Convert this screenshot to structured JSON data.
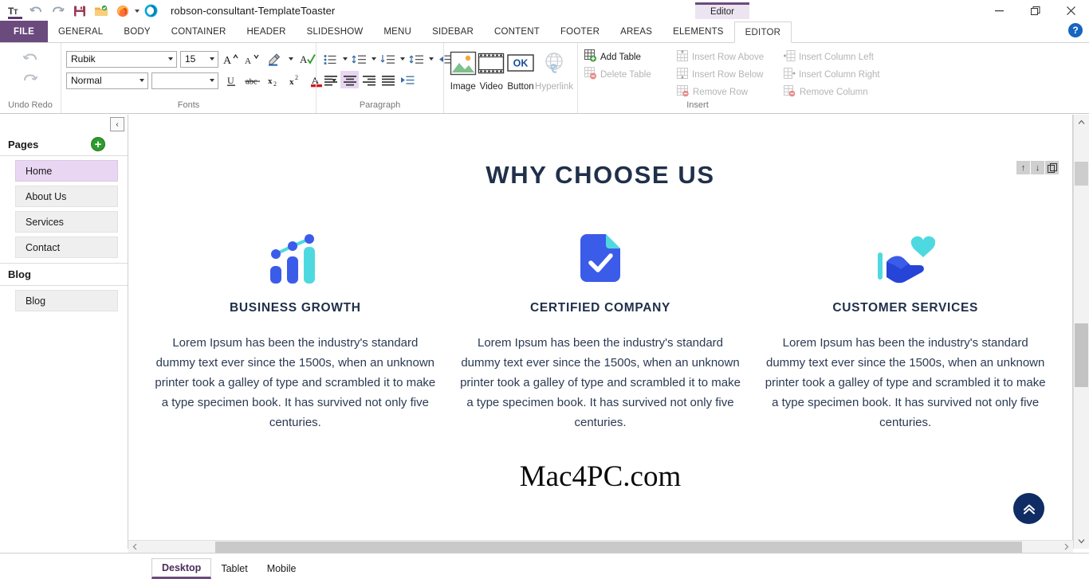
{
  "titlebar": {
    "quick_access": [
      {
        "name": "text-tool-icon",
        "label": "Tt"
      },
      {
        "name": "undo-icon",
        "label": "Undo"
      },
      {
        "name": "redo-icon",
        "label": "Redo"
      },
      {
        "name": "save-icon",
        "label": "Save"
      },
      {
        "name": "open-folder-icon",
        "label": "Open"
      },
      {
        "name": "firefox-preview-icon",
        "label": "Preview in Firefox"
      },
      {
        "name": "templatetoaster-icon",
        "label": "TemplateToaster"
      }
    ],
    "title": "robson-consultant-TemplateToaster",
    "doc_tab": "Editor",
    "window_controls": {
      "minimize": "—",
      "maximize": "❐",
      "close": "✕"
    },
    "help": "?"
  },
  "ribbon_tabs": {
    "file": "FILE",
    "items": [
      {
        "label": "GENERAL",
        "active": false
      },
      {
        "label": "BODY",
        "active": false
      },
      {
        "label": "CONTAINER",
        "active": false
      },
      {
        "label": "HEADER",
        "active": false
      },
      {
        "label": "SLIDESHOW",
        "active": false
      },
      {
        "label": "MENU",
        "active": false
      },
      {
        "label": "SIDEBAR",
        "active": false
      },
      {
        "label": "CONTENT",
        "active": false
      },
      {
        "label": "FOOTER",
        "active": false
      },
      {
        "label": "AREAS",
        "active": false
      },
      {
        "label": "ELEMENTS",
        "active": false
      },
      {
        "label": "EDITOR",
        "active": true
      }
    ]
  },
  "ribbon": {
    "undo_group": {
      "label": "Undo Redo",
      "undo": "Undo",
      "redo": "Redo"
    },
    "fonts_group": {
      "label": "Fonts",
      "font_family": "Rubik",
      "font_size": "15",
      "style": "Normal",
      "style2": "",
      "grow_font": "A",
      "shrink_font": "A",
      "highlight": "Highlight Color",
      "spelling": "Spelling",
      "underline": "U",
      "strikethrough": "abc",
      "subscript": "x₂",
      "superscript": "x²",
      "font_color": "A",
      "clear_format": "A"
    },
    "paragraph_group": {
      "label": "Paragraph",
      "bullets": "Bullets",
      "numbering": "Numbering",
      "line_spacing": "Line Spacing",
      "multilevel": "Multilevel List",
      "indent": "Increase Indent",
      "format_painter": "Format Painter",
      "align_left": "Align Left",
      "align_center": "Align Center",
      "align_right": "Align Right",
      "justify": "Justify",
      "outdent": "Decrease Indent"
    },
    "insert_group": {
      "label": "Insert",
      "buttons": [
        {
          "label": "Image",
          "icon": "image-icon",
          "disabled": false
        },
        {
          "label": "Video",
          "icon": "video-icon",
          "disabled": false
        },
        {
          "label": "Button",
          "icon": "button-ok-icon",
          "disabled": false,
          "glyph": "OK"
        },
        {
          "label": "Hyperlink",
          "icon": "hyperlink-icon",
          "disabled": true
        }
      ],
      "table_col1": [
        {
          "label": "Add Table",
          "icon": "add-table-icon",
          "disabled": false
        },
        {
          "label": "Delete Table",
          "icon": "delete-table-icon",
          "disabled": true
        }
      ],
      "table_col2": [
        {
          "label": "Insert Row Above",
          "icon": "insert-row-above-icon",
          "disabled": true
        },
        {
          "label": "Insert Row Below",
          "icon": "insert-row-below-icon",
          "disabled": true
        },
        {
          "label": "Remove Row",
          "icon": "remove-row-icon",
          "disabled": true
        }
      ],
      "table_col3": [
        {
          "label": "Insert Column Left",
          "icon": "insert-column-left-icon",
          "disabled": true
        },
        {
          "label": "Insert Column Right",
          "icon": "insert-column-right-icon",
          "disabled": true
        },
        {
          "label": "Remove Column",
          "icon": "remove-column-icon",
          "disabled": true
        }
      ]
    }
  },
  "sidebar": {
    "collapse": "‹",
    "pages_heading": "Pages",
    "add_page": "+",
    "pages": [
      {
        "label": "Home",
        "active": true
      },
      {
        "label": "About Us",
        "active": false
      },
      {
        "label": "Services",
        "active": false
      },
      {
        "label": "Contact",
        "active": false
      }
    ],
    "blog_heading": "Blog",
    "blog_items": [
      {
        "label": "Blog",
        "active": false
      }
    ]
  },
  "canvas": {
    "page_title": "WHY CHOOSE US",
    "columns": [
      {
        "icon": "bar-chart-growth-icon",
        "title": "BUSINESS GROWTH",
        "text": "Lorem Ipsum has been the industry's standard dummy text ever since the 1500s, when an unknown printer took a galley of type and scrambled it to make a type specimen book. It has survived not only five centuries."
      },
      {
        "icon": "certified-document-check-icon",
        "title": "CERTIFIED COMPANY",
        "text": "Lorem Ipsum has been the industry's standard dummy text ever since the 1500s, when an unknown printer took a galley of type and scrambled it to make a type specimen book. It has survived not only five centuries."
      },
      {
        "icon": "hand-heart-care-icon",
        "title": "CUSTOMER SERVICES",
        "text": "Lorem Ipsum has been the industry's standard dummy text ever since the 1500s, when an unknown printer took a galley of type and scrambled it to make a type specimen book. It has survived not only five centuries."
      }
    ],
    "watermark": "Mac4PC.com",
    "element_tools": [
      {
        "name": "move-up-icon",
        "glyph": "↑"
      },
      {
        "name": "move-down-icon",
        "glyph": "↓"
      },
      {
        "name": "duplicate-icon",
        "glyph": "❐"
      }
    ],
    "scroll_top_glyph": "»"
  },
  "statusbar": {
    "views": [
      {
        "label": "Desktop",
        "active": true
      },
      {
        "label": "Tablet",
        "active": false
      },
      {
        "label": "Mobile",
        "active": false
      }
    ]
  },
  "colors": {
    "accent_purple": "#6b4a7d",
    "page_active": "#e8d6f2",
    "heading_navy": "#20304a",
    "icon_blue": "#3b5ce8",
    "icon_teal": "#4ed9e0",
    "add_green": "#2e9b2e",
    "scroll_top_navy": "#0f2d64"
  }
}
